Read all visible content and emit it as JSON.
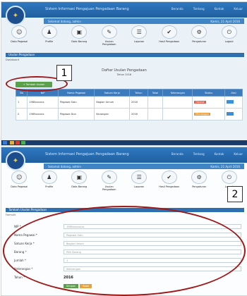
{
  "callouts": {
    "first": "1",
    "second": "2"
  },
  "header": {
    "system_name": "Sistem Informasi Pengajuan Pengadaan Barang",
    "links": [
      "Beranda",
      "Tentang",
      "Kontak",
      "Keluar"
    ]
  },
  "userbar": {
    "left": "Selamat datang, admin",
    "right": "Kamis, 21 April 2016"
  },
  "menu": [
    {
      "label": "Data Pegawai",
      "icon": "users-icon",
      "glyph": "☺"
    },
    {
      "label": "Profile",
      "icon": "profile-icon",
      "glyph": "♟"
    },
    {
      "label": "Data Barang",
      "icon": "box-icon",
      "glyph": "▣"
    },
    {
      "label": "Usulan Pengadaan",
      "icon": "document-icon",
      "glyph": "✎"
    },
    {
      "label": "Laporan",
      "icon": "report-icon",
      "glyph": "☰"
    },
    {
      "label": "Hasil Pengadaan",
      "icon": "check-icon",
      "glyph": "✔"
    },
    {
      "label": "Pengaturan",
      "icon": "gear-icon",
      "glyph": "⚙"
    },
    {
      "label": "Logout",
      "icon": "logout-icon",
      "glyph": "⏻"
    }
  ],
  "screen1": {
    "section_title": "Usulan Pengadaan",
    "meta": "Dashboard",
    "add_button": "+ Tambah Usulan",
    "table_heading": "Daftar Usulan Pengadaan",
    "table_subheading": "Tahun 2016",
    "columns": [
      "No",
      "NIP",
      "Nama Pegawai",
      "Satuan Kerja",
      "Tahun",
      "Total",
      "Keterangan",
      "Status",
      "Aksi"
    ],
    "rows": [
      {
        "no": "1",
        "nip": "1980xxxxxx",
        "nama": "Pegawai Satu",
        "satker": "Bagian Umum",
        "tahun": "2016",
        "total": "",
        "ket": "",
        "status": "Ditolak",
        "status_kind": "red"
      },
      {
        "no": "2",
        "nip": "1985xxxxxx",
        "nama": "Pegawai Dua",
        "satker": "Keuangan",
        "tahun": "2016",
        "total": "",
        "ket": "",
        "status": "Menunggu",
        "status_kind": "orange"
      }
    ]
  },
  "screen2": {
    "section_title": "Tambah Usulan Pengadaan",
    "form_caption": "Formulir",
    "fields": [
      {
        "label": "NIP *",
        "value": "1980xxxxxxxx"
      },
      {
        "label": "Nama Pegawai *",
        "value": "Pegawai Satu"
      },
      {
        "label": "Satuan Kerja *",
        "value": "Bagian Umum"
      },
      {
        "label": "Barang *",
        "value": "Pilih Barang"
      },
      {
        "label": "Jumlah *",
        "value": "1"
      },
      {
        "label": "Keterangan *",
        "value": "Keterangan"
      }
    ],
    "year_label": "Tahun *",
    "year_value": "2016",
    "save": "Simpan",
    "cancel": "Batal"
  }
}
